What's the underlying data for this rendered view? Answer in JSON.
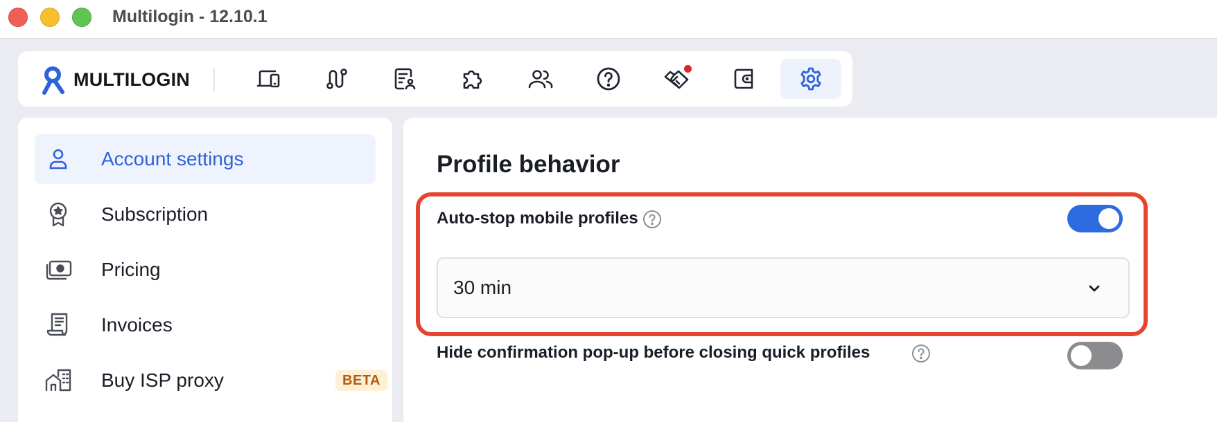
{
  "window": {
    "title": "Multilogin - 12.10.1"
  },
  "brand": {
    "name": "MULTILOGIN"
  },
  "topnav": {
    "items": [
      {
        "icon": "devices-icon",
        "active": false
      },
      {
        "icon": "route-icon",
        "active": false
      },
      {
        "icon": "profile-list-icon",
        "active": false
      },
      {
        "icon": "extension-puzzle-icon",
        "active": false
      },
      {
        "icon": "team-users-icon",
        "active": false
      },
      {
        "icon": "help-icon",
        "active": false
      },
      {
        "icon": "handshake-icon",
        "active": false,
        "notification": true
      },
      {
        "icon": "wallet-icon",
        "active": false
      },
      {
        "icon": "gear-icon",
        "active": true
      }
    ]
  },
  "sidebar": {
    "items": [
      {
        "label": "Account settings",
        "icon": "user-icon",
        "active": true
      },
      {
        "label": "Subscription",
        "icon": "award-badge-icon",
        "active": false
      },
      {
        "label": "Pricing",
        "icon": "cash-icon",
        "active": false
      },
      {
        "label": "Invoices",
        "icon": "receipt-icon",
        "active": false
      },
      {
        "label": "Buy ISP proxy",
        "icon": "buildings-icon",
        "active": false,
        "badge": "BETA"
      }
    ]
  },
  "main": {
    "section_title": "Profile behavior",
    "settings": [
      {
        "label": "Auto-stop mobile profiles",
        "enabled": true,
        "select_value": "30 min"
      },
      {
        "label": "Hide confirmation pop-up before closing quick profiles",
        "enabled": false
      }
    ]
  },
  "colors": {
    "accent": "#2d6be1",
    "highlight_border": "#e8432e",
    "notification": "#d9262b",
    "beta_bg": "#fdf0d5",
    "beta_text": "#b35b12"
  }
}
